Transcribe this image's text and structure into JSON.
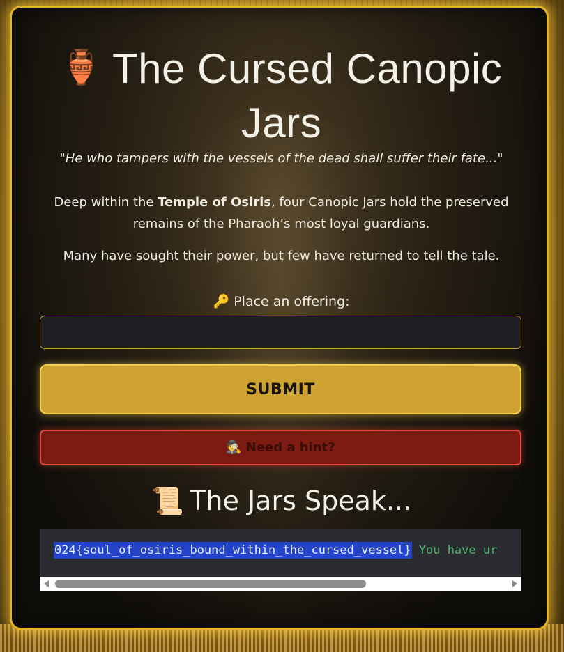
{
  "header": {
    "vase_icon": "🏺",
    "title": "The Cursed Canopic Jars"
  },
  "quote": "\"He who tampers with the vessels of the dead shall suffer their fate...\"",
  "intro": {
    "before": "Deep within the ",
    "bold": "Temple of Osiris",
    "after": ", four Canopic Jars hold the preserved remains of the Pharaoh’s most loyal guardians."
  },
  "legend": "Many have sought their power, but few have returned to tell the tale.",
  "offering": {
    "key_icon": "🔑",
    "label": "Place an offering:",
    "value": "",
    "placeholder": ""
  },
  "submit_label": "SUBMIT",
  "hint": {
    "icon": "🕵",
    "label": "Need a hint?"
  },
  "output": {
    "scroll_icon": "📜",
    "heading": "The Jars Speak...",
    "flag": "024{soul_of_osiris_bound_within_the_cursed_vessel}",
    "tail": "You have ur"
  },
  "colors": {
    "accent_gold": "#e3b42a",
    "submit_bg": "#cfa332",
    "hint_bg": "#7c1b12",
    "hint_border": "#e0473f",
    "output_text": "#4fb26a",
    "selection": "#2545c9"
  }
}
